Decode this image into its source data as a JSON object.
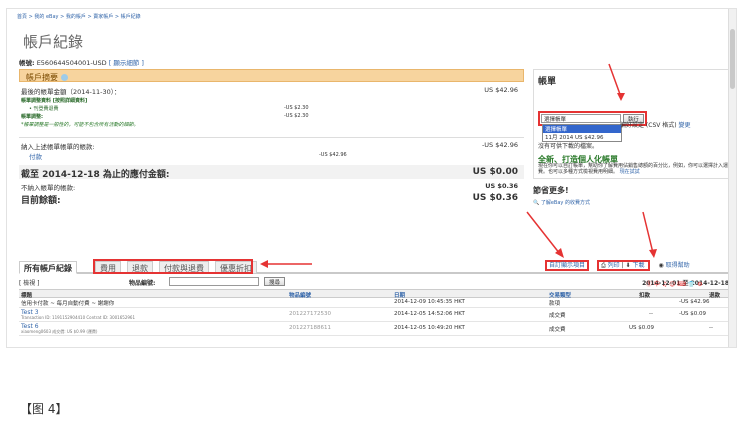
{
  "breadcrumb": "首頁 > 我的 eBay > 我的帳戶 > 賣家帳戶 > 帳戶紀錄",
  "page_title": "帳戶紀錄",
  "account": {
    "label": "帳號:",
    "id": "E560644504001-USD",
    "link": "[ 顯示細節 ]"
  },
  "summary": {
    "title": "帳戶摘要",
    "rows": [
      {
        "label": "最後的帳單金額（2014-11-30）：",
        "amount": "US $42.96"
      },
      {
        "label": "進行中的 eBay 費用",
        "amount": ""
      },
      {
        "label": "帳單調整:",
        "amount": ""
      },
      {
        "label": "納入上述帳單帳單的帳款:",
        "amount": "-US $42.96"
      },
      {
        "label": "付款",
        "amount": "-US $42.96"
      },
      {
        "label": "截至 2014-12-18 為止的應付金額:",
        "amount": "US $0.00"
      },
      {
        "label": "不納入帳單的帳款:",
        "amount": "US $0.36"
      },
      {
        "label": "目前餘額:",
        "amount": "US $0.36"
      }
    ],
    "sub_amounts": [
      "-US $2.30",
      "-US $2.30"
    ],
    "sub_items": [
      "帳單調整資料 [按照詳細資料]",
      "• 刊登費退費",
      "帳單調整:"
    ],
    "note": "*帳單調整是一般性的，可能不包含所有活動的細節。"
  },
  "invoice": {
    "title": "帳單",
    "select_label": "選擇帳單",
    "select_value": "11月 2014 US $42.96",
    "go_label": "執行",
    "options": [
      "選擇帳單",
      "11月 2014 US $42.96"
    ],
    "prefs_text": "偏好設定 (CSV 格式)",
    "change_link": "變更",
    "no_bill": "沒有可供下載的檔案。",
    "promo_title": "全新、打造個人化帳單",
    "promo_text": "現在你可以自訂帳單，幫助你了解費用佔銷售總額的百分比，例如，你可以選擇計入運費。也可以多種方式檢視費用明細。",
    "promo_link": "現在試試",
    "save_title": "節省更多!",
    "save_link": "了解eBay 的收費方式"
  },
  "tabs": [
    "所有帳戶紀錄",
    "費用",
    "退款",
    "付款與退費",
    "優惠折扣"
  ],
  "tools": {
    "custom_view": "自訂顯示項目",
    "print": "列印",
    "download": "下載",
    "help": "取得幫助"
  },
  "filter": {
    "view_label": "[ 檢視 ]",
    "item_label": "物品編號:",
    "search_btn": "搜尋",
    "date_range": "2014-12-01 至 2014-12-18"
  },
  "table": {
    "headers": [
      "標題",
      "物品編號",
      "日期",
      "交易類型",
      "扣款",
      "退款"
    ],
    "rows": [
      {
        "title": "信用卡付款 ~ 每月自動付費 ~ 謝謝你",
        "sub": "",
        "item": "",
        "date": "2014-12-09 10:45:35 HKT",
        "type": "款項",
        "debit": "",
        "credit": "-US $42.96"
      },
      {
        "title": "Test 3",
        "sub": "Transaction ID: 1191152904410 Contrat ID: 3001652961",
        "item": "201227172530",
        "date": "2014-12-05 14:52:06 HKT",
        "type": "成交費",
        "debit": "--",
        "credit": "-US $0.09"
      },
      {
        "title": "Test 6",
        "sub": "xiaomeng0603 成交價: US $0.99 (運費)",
        "item": "201227188611",
        "date": "2014-12-05 10:49:20 HKT",
        "type": "成交費",
        "debit": "US $0.09",
        "credit": "--"
      }
    ]
  },
  "caption": "【图 4】",
  "colors": {
    "accent_red": "#e53333",
    "summary_bar": "#f7d49e",
    "link": "#3366aa"
  },
  "icons": [
    "help-circle-icon",
    "print-icon",
    "download-icon",
    "help-icon",
    "magnifier-icon"
  ]
}
